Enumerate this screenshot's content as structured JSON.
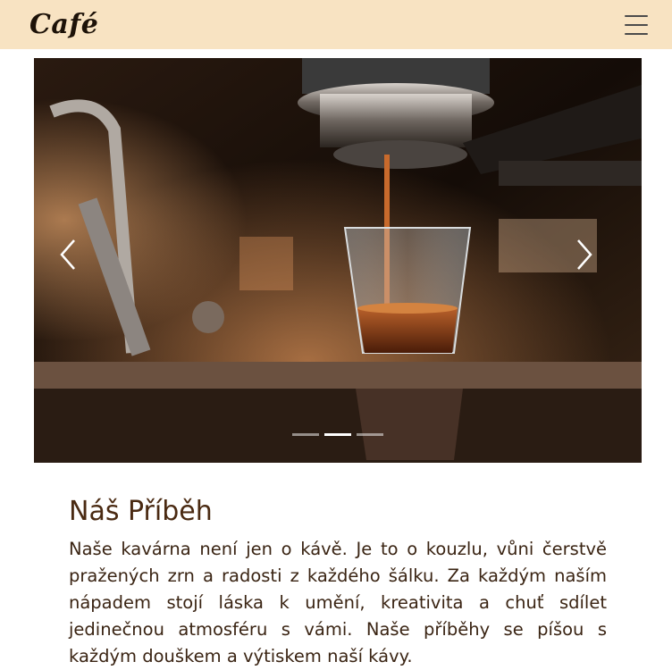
{
  "navbar": {
    "brand": "Café",
    "menu_icon": "hamburger-menu-icon"
  },
  "carousel": {
    "slide_alt": "Espresso pouring from machine into glass",
    "slide_count": 3,
    "active_index": 1,
    "prev_icon": "chevron-left-icon",
    "next_icon": "chevron-right-icon"
  },
  "story": {
    "title": "Náš Příběh",
    "text": "Naše kavárna není jen o kávě. Je to o kouzlu, vůni čerstvě pražených zrn a radosti z každého šálku. Za každým naším nápadem stojí láska k umění, kreativita a chuť sdílet jedinečnou atmosféru s vámi. Naše příběhy se píšou s každým douškem a výtiskem naší kávy."
  },
  "colors": {
    "navbar_bg": "#f8e3c2",
    "heading": "#4a2a12",
    "text": "#3a2413"
  }
}
